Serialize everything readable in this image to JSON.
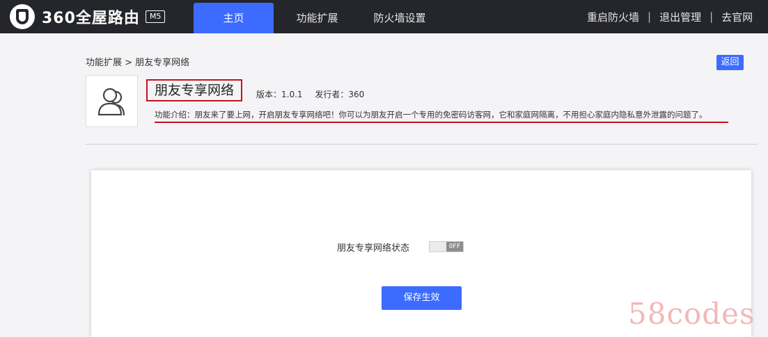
{
  "brand": {
    "name": "360全屋路由",
    "model": "M5"
  },
  "nav": {
    "tabs": [
      {
        "label": "主页",
        "active": true
      },
      {
        "label": "功能扩展",
        "active": false
      },
      {
        "label": "防火墙设置",
        "active": false
      }
    ],
    "right_links": [
      "重启防火墙",
      "退出管理",
      "去官网"
    ],
    "separator": "|"
  },
  "breadcrumb": "功能扩展 > 朋友专享网络",
  "back_label": "返回",
  "app": {
    "icon": "user-group-icon",
    "title": "朋友专享网络",
    "version": "版本：1.0.1",
    "publisher": "发行者：360",
    "description": "功能介绍：朋友来了要上网，开启朋友专享网络吧！你可以为朋友开启一个专用的免密码访客网，它和家庭网隔离，不用担心家庭内隐私意外泄露的问题了。"
  },
  "panel": {
    "status_label": "朋友专享网络状态",
    "toggle_text": "OFF",
    "toggle_on": false,
    "save_label": "保存生效"
  },
  "watermark": "58codes",
  "colors": {
    "accent": "#3c6bff",
    "topbar": "#25262b",
    "highlight": "#c7101b"
  }
}
